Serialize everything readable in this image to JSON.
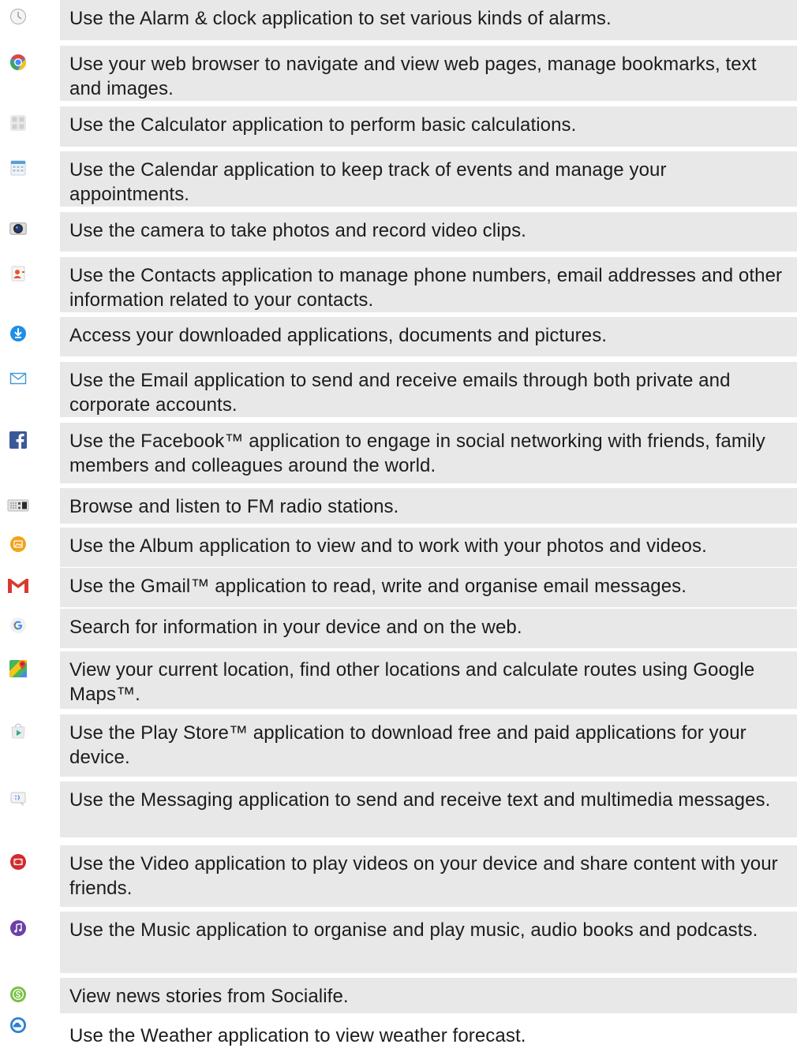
{
  "apps": [
    {
      "icon": "alarm-clock-icon",
      "description": "Use the Alarm & clock application to set various kinds of alarms."
    },
    {
      "icon": "browser-icon",
      "description": "Use your web browser to navigate and view web pages, manage bookmarks, text and images."
    },
    {
      "icon": "calculator-icon",
      "description": "Use the Calculator application to perform basic calculations."
    },
    {
      "icon": "calendar-icon",
      "description": "Use the Calendar application to keep track of events and manage your appointments."
    },
    {
      "icon": "camera-icon",
      "description": "Use the camera to take photos and record video clips."
    },
    {
      "icon": "contacts-icon",
      "description": "Use the Contacts application to manage phone numbers, email addresses and other information related to your contacts."
    },
    {
      "icon": "downloads-icon",
      "description": "Access your downloaded applications, documents and pictures."
    },
    {
      "icon": "email-icon",
      "description": "Use the Email application to send and receive emails through both private and corporate accounts."
    },
    {
      "icon": "facebook-icon",
      "description": "Use the Facebook™ application to engage in social networking with friends, family members and colleagues around the world."
    },
    {
      "icon": "fm-radio-icon",
      "description": "Browse and listen to FM radio stations."
    },
    {
      "icon": "album-icon",
      "description": "Use the Album application to view and to work with your photos and videos."
    },
    {
      "icon": "gmail-icon",
      "description": "Use the Gmail™ application to read, write and organise email messages."
    },
    {
      "icon": "google-search-icon",
      "description": "Search for information in your device and on the web."
    },
    {
      "icon": "maps-icon",
      "description": "View your current location, find other locations and calculate routes using Google Maps™."
    },
    {
      "icon": "play-store-icon",
      "description": "Use the Play Store™ application to download free and paid applications for your device."
    },
    {
      "icon": "messaging-icon",
      "description": "Use the Messaging application to send and receive text and multimedia messages."
    },
    {
      "icon": "video-icon",
      "description": "Use the Video application to play videos on your device and share content with your friends."
    },
    {
      "icon": "music-icon",
      "description": "Use the Music application to organise and play music, audio books and podcasts."
    },
    {
      "icon": "socialife-icon",
      "description": "View news stories from Socialife."
    },
    {
      "icon": "weather-icon",
      "description": "Use the Weather application to view weather forecast."
    }
  ]
}
